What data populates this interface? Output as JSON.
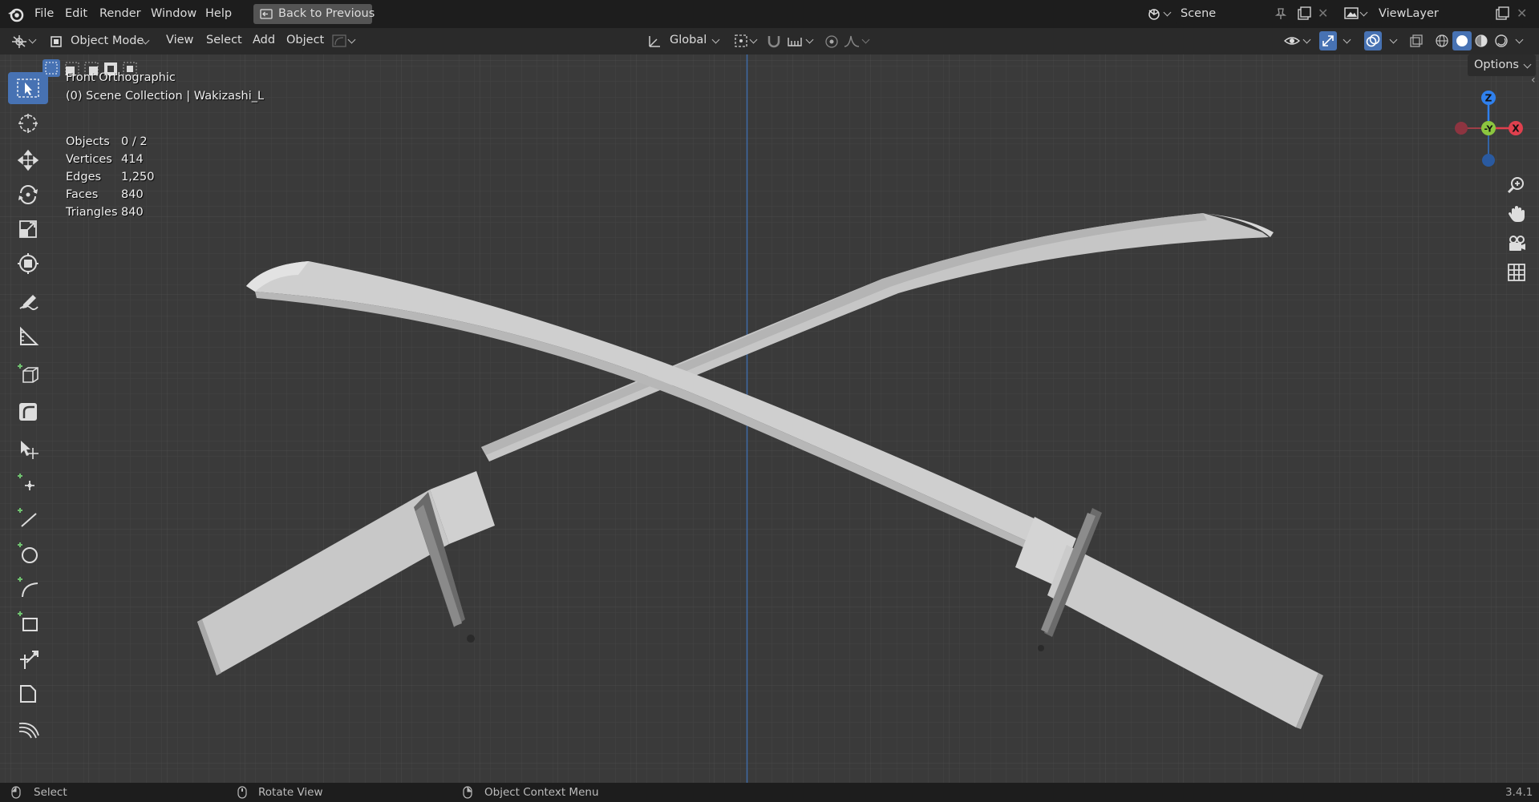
{
  "menu": {
    "file": "File",
    "edit": "Edit",
    "render": "Render",
    "window": "Window",
    "help": "Help",
    "back": "Back to Previous"
  },
  "scene": {
    "name": "Scene",
    "view_layer": "ViewLayer"
  },
  "header": {
    "mode": "Object Mode",
    "view": "View",
    "select": "Select",
    "add": "Add",
    "object": "Object",
    "orientation": "Global",
    "options": "Options"
  },
  "overlay": {
    "view_name": "Front Orthographic",
    "collection": "(0) Scene Collection | Wakizashi_L",
    "stats": [
      {
        "label": "Objects",
        "value": "0 / 2"
      },
      {
        "label": "Vertices",
        "value": "414"
      },
      {
        "label": "Edges",
        "value": "1,250"
      },
      {
        "label": "Faces",
        "value": "840"
      },
      {
        "label": "Triangles",
        "value": "840"
      }
    ]
  },
  "gizmo": {
    "z": "Z",
    "y": "-Y",
    "x": "X"
  },
  "status": {
    "select": "Select",
    "rotate": "Rotate View",
    "context": "Object Context Menu",
    "version": "3.4.1"
  },
  "colors": {
    "active_tool": "#4772b3",
    "x_axis": "#e0404e",
    "y_axis": "#8cc63f",
    "z_axis": "#2f80ed",
    "background": "#3a3a3a"
  }
}
